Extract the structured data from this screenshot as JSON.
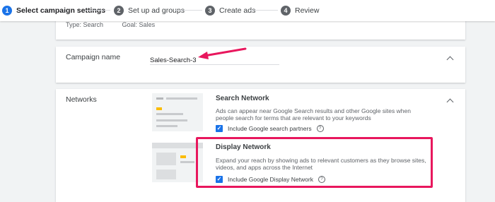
{
  "stepper": {
    "steps": [
      {
        "num": "1",
        "label": "Select campaign settings"
      },
      {
        "num": "2",
        "label": "Set up ad groups"
      },
      {
        "num": "3",
        "label": "Create ads"
      },
      {
        "num": "4",
        "label": "Review"
      }
    ]
  },
  "summary": {
    "type_text": "Type: Search",
    "goal_text": "Goal: Sales"
  },
  "campaign_name": {
    "label": "Campaign name",
    "value": "Sales-Search-3"
  },
  "networks": {
    "label": "Networks",
    "search": {
      "title": "Search Network",
      "desc": "Ads can appear near Google Search results and other Google sites when people search for terms that are relevant to your keywords",
      "checkbox_label": "Include Google search partners",
      "checked": true
    },
    "display": {
      "title": "Display Network",
      "desc": "Expand your reach by showing ads to relevant customers as they browse sites, videos, and apps across the Internet",
      "checkbox_label": "Include Google Display Network",
      "checked": true
    }
  },
  "icons": {
    "check": "✓",
    "help": "?"
  },
  "colors": {
    "accent": "#1a73e8",
    "annotation": "#e8175d",
    "step_inactive": "#5f6368"
  }
}
